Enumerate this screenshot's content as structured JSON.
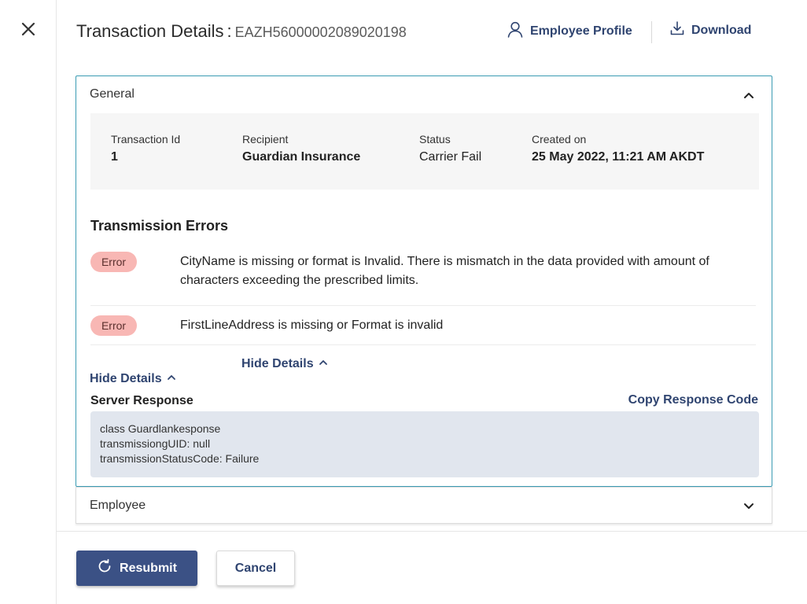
{
  "header": {
    "title": "Transaction Details",
    "separator": ":",
    "transaction_code": "EAZH56000002089020198",
    "employee_profile_label": "Employee Profile",
    "download_label": "Download"
  },
  "general": {
    "label": "General",
    "summary": {
      "transaction_id": {
        "label": "Transaction Id",
        "value": "1"
      },
      "recipient": {
        "label": "Recipient",
        "value": "Guardian Insurance"
      },
      "status": {
        "label": "Status",
        "value": "Carrier Fail"
      },
      "created_on": {
        "label": "Created on",
        "value": "25 May 2022, 11:21 AM AKDT"
      }
    },
    "transmission_errors": {
      "title": "Transmission Errors",
      "items": [
        {
          "badge": "Error",
          "message": "CityName is missing or format is Invalid. There is mismatch in the data provided with amount of characters exceeding the prescribed limits."
        },
        {
          "badge": "Error",
          "message": "FirstLineAddress is missing or Format is invalid"
        }
      ],
      "hide_details_inline": "Hide Details"
    },
    "hide_details": "Hide Details",
    "server_response": {
      "title": "Server Response",
      "copy_label": "Copy Response Code",
      "lines": [
        "class Guardlankesponse",
        "transmissiongUID: null",
        "transmissionStatusCode: Failure"
      ]
    }
  },
  "employee": {
    "label": "Employee"
  },
  "footer": {
    "resubmit_label": "Resubmit",
    "cancel_label": "Cancel"
  },
  "colors": {
    "accent": "#3b5185",
    "link": "#2f4470",
    "panel_border": "#3a9bb3",
    "error_badge": "#f8b7b4",
    "code_bg": "#e1e6ee"
  },
  "icons": {
    "close": "close-icon",
    "profile": "user-icon",
    "download": "download-icon",
    "collapse": "chevron-up-icon",
    "expand": "chevron-down-icon",
    "resubmit": "refresh-icon"
  }
}
